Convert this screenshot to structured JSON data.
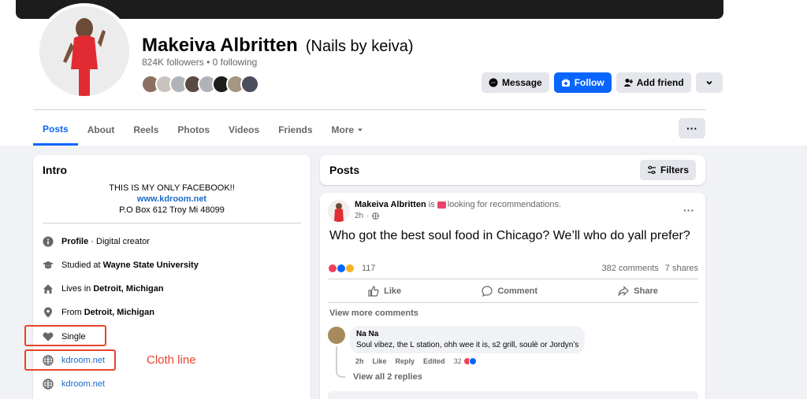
{
  "profile": {
    "name": "Makeiva Albritten",
    "alt_name": "(Nails by keiva)",
    "followers_text": "824K followers",
    "following_text": "0 following",
    "separator": "•"
  },
  "actions": {
    "message": "Message",
    "follow": "Follow",
    "add_friend": "Add friend"
  },
  "tabs": [
    "Posts",
    "About",
    "Reels",
    "Photos",
    "Videos",
    "Friends",
    "More"
  ],
  "intro": {
    "title": "Intro",
    "bio_line1": "THIS IS MY ONLY FACEBOOK!!",
    "bio_link": "www.kdroom.net",
    "bio_line3": "P.O Box 612 Troy Mi 48099",
    "profile_label": "Profile",
    "profile_value": " · Digital creator",
    "studied_prefix": "Studied at ",
    "studied_value": "Wayne State University",
    "lives_prefix": "Lives in ",
    "lives_value": "Detroit, Michigan",
    "from_prefix": "From ",
    "from_value": "Detroit, Michigan",
    "relationship": "Single",
    "website1": "kdroom.net",
    "website2": "kdroom.net"
  },
  "annotation": {
    "cloth_line": "Cloth line"
  },
  "posts_header": {
    "title": "Posts",
    "filters": "Filters"
  },
  "post": {
    "author": "Makeiva Albritten",
    "is": " is ",
    "status": "looking for recommendations.",
    "time": "2h",
    "text": "Who got the best soul food in Chicago? We’ll who do yall prefer?",
    "reaction_count": "117",
    "comments": "382 comments",
    "shares": "7 shares",
    "like": "Like",
    "comment": "Comment",
    "share": "Share",
    "view_more": "View more comments",
    "comment_author": "Na Na",
    "comment_text": "Soul vibez, the L station, ohh wee it is, s2 grill, soulè or Jordyn’s",
    "comment_time": "2h",
    "comment_like": "Like",
    "comment_reply": "Reply",
    "comment_edited": "Edited",
    "comment_reactions": "32",
    "view_replies": "View all 2 replies"
  },
  "colors": {
    "accent": "#0866ff",
    "annotation": "#e8442c"
  }
}
